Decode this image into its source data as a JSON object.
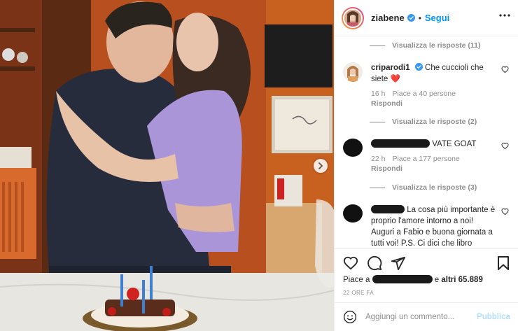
{
  "header": {
    "username": "ziabene",
    "dot": "•",
    "follow_label": "Segui"
  },
  "comments": {
    "replies_1": "Visualizza le risposte (11)",
    "c1": {
      "username": "criparodi1",
      "text": "Che cuccioli che siete",
      "emoji": "❤️",
      "age": "16 h",
      "likes": "Piace a 40 persone",
      "reply": "Rispondi"
    },
    "replies_2": "Visualizza le risposte (2)",
    "c2": {
      "text": "VATE GOAT",
      "age": "22 h",
      "likes": "Piace a 177 persone",
      "reply": "Rispondi"
    },
    "replies_3": "Visualizza le risposte (3)",
    "c3": {
      "text_line1": "La cosa più importante",
      "text_rest": "è proprio l'amore intorno a noi! Auguri a Fabio e buona giornata a tutti voi! P.S. Ci dici che libro"
    }
  },
  "actions": {
    "likes_prefix": "Piace a",
    "likes_suffix": "e",
    "likes_bold": "altri 65.889",
    "time": "22 ORE FA"
  },
  "composer": {
    "placeholder": "Aggiungi un commento...",
    "publish_label": "Pubblica"
  },
  "colors": {
    "link": "#0095f6",
    "muted": "#8e8e8e",
    "publish_disabled": "#b2dffc",
    "wall": "#c65a22"
  }
}
